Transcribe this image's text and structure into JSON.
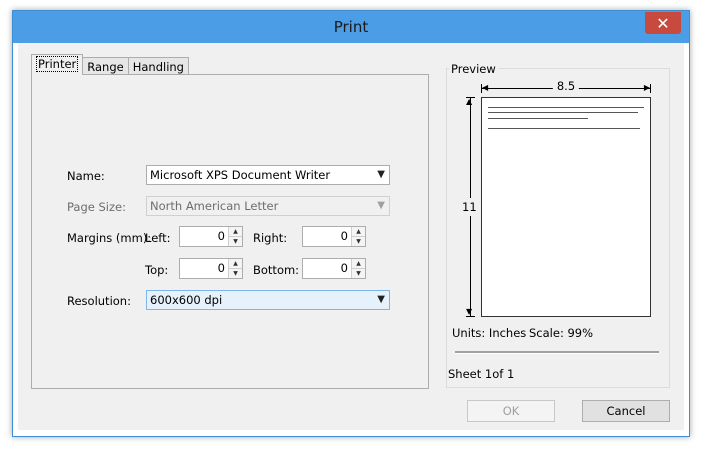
{
  "window": {
    "title": "Print",
    "close_glyph": "✕"
  },
  "tabs": [
    {
      "label": "Printer",
      "active": true
    },
    {
      "label": "Range",
      "active": false
    },
    {
      "label": "Handling",
      "active": false
    }
  ],
  "printer": {
    "name_label": "Name:",
    "name_value": "Microsoft XPS Document Writer",
    "page_size_label": "Page Size:",
    "page_size_value": "North American Letter",
    "margins_label": "Margins (mm):",
    "left_label": "Left:",
    "left_value": "0",
    "right_label": "Right:",
    "right_value": "0",
    "top_label": "Top:",
    "top_value": "0",
    "bottom_label": "Bottom:",
    "bottom_value": "0",
    "resolution_label": "Resolution:",
    "resolution_value": "600x600 dpi"
  },
  "preview": {
    "legend": "Preview",
    "width_label": "8.5",
    "height_label": "11",
    "units_text": "Units: Inches",
    "scale_text": "Scale: 99%",
    "sheet_text": "Sheet 1of 1"
  },
  "buttons": {
    "ok": "OK",
    "cancel": "Cancel"
  },
  "icons": {
    "close": "close-icon",
    "dropdown": "chevron-down-icon",
    "spin_up": "arrow-up-icon",
    "spin_down": "arrow-down-icon"
  },
  "colors": {
    "titlebar": "#4b9ee5",
    "close": "#c74a3f",
    "client": "#f0f0f0",
    "select_highlight": "#e5f1fb"
  }
}
